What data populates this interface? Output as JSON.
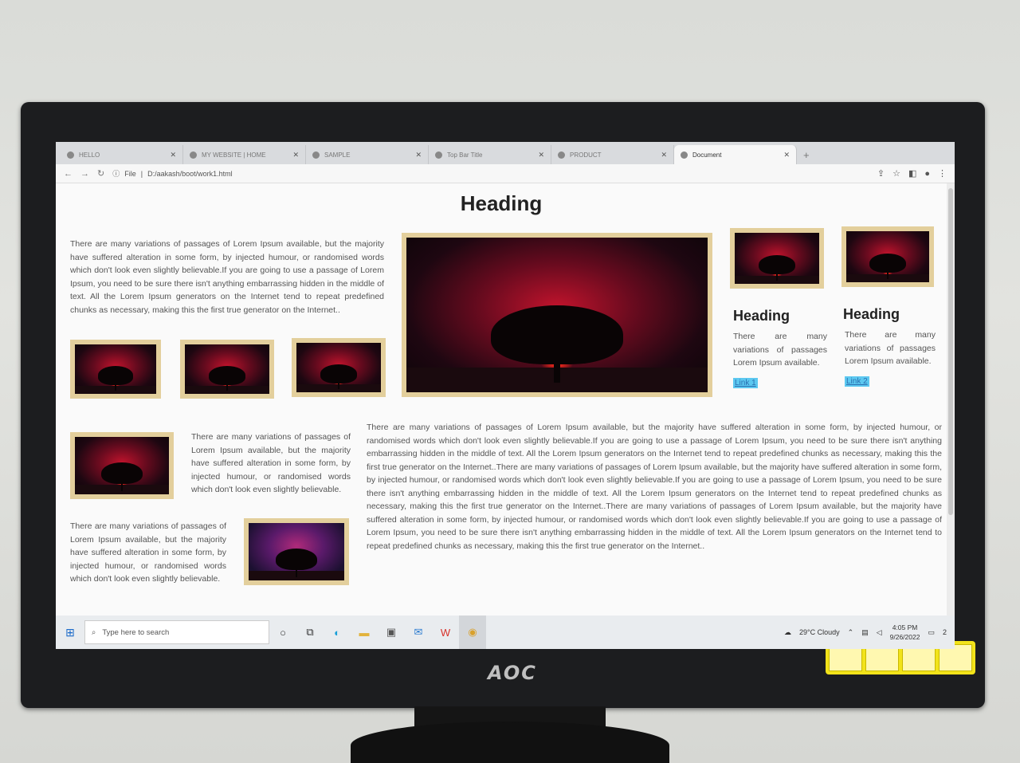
{
  "monitor": {
    "brand": "AOC"
  },
  "browser": {
    "tabs": [
      {
        "label": "HELLO",
        "active": false
      },
      {
        "label": "MY WEBSITE | HOME",
        "active": false
      },
      {
        "label": "SAMPLE",
        "active": false
      },
      {
        "label": "Top Bar Title",
        "active": false
      },
      {
        "label": "PRODUCT",
        "active": false
      },
      {
        "label": "Document",
        "active": true
      }
    ],
    "new_tab": "+",
    "address": {
      "scheme": "File",
      "path": "D:/aakash/boot/work1.html"
    }
  },
  "page": {
    "heading": "Heading",
    "intro_paragraph": "There are many variations of passages of Lorem Ipsum available, but the majority have suffered alteration in some form, by injected humour, or randomised words which don't look even slightly believable.If you are going to use a passage of Lorem Ipsum, you need to be sure there isn't anything embarrassing hidden in the middle of text. All the Lorem Ipsum generators on the Internet tend to repeat predefined chunks as necessary, making this the first true generator on the Internet..",
    "cards": [
      {
        "title": "Heading",
        "text": "There are many variations of passages Lorem Ipsum available.",
        "link": "Link 1"
      },
      {
        "title": "Heading",
        "text": "There are many variations of passages Lorem Ipsum available.",
        "link": "Link 2"
      }
    ],
    "media_text_1": "There are many variations of passages of Lorem Ipsum available, but the majority have suffered alteration in some form, by injected humour, or randomised words which don't look even slightly believable.",
    "media_text_2": "There are many variations of passages of Lorem Ipsum available, but the majority have suffered alteration in some form, by injected humour, or randomised words which don't look even slightly believable.",
    "long_paragraph": "There are many variations of passages of Lorem Ipsum available, but the majority have suffered alteration in some form, by injected humour, or randomised words which don't look even slightly believable.If you are going to use a passage of Lorem Ipsum, you need to be sure there isn't anything embarrassing hidden in the middle of text. All the Lorem Ipsum generators on the Internet tend to repeat predefined chunks as necessary, making this the first true generator on the Internet..There are many variations of passages of Lorem Ipsum available, but the majority have suffered alteration in some form, by injected humour, or randomised words which don't look even slightly believable.If you are going to use a passage of Lorem Ipsum, you need to be sure there isn't anything embarrassing hidden in the middle of text. All the Lorem Ipsum generators on the Internet tend to repeat predefined chunks as necessary, making this the first true generator on the Internet..There are many variations of passages of Lorem Ipsum available, but the majority have suffered alteration in some form, by injected humour, or randomised words which don't look even slightly believable.If you are going to use a passage of Lorem Ipsum, you need to be sure there isn't anything embarrassing hidden in the middle of text. All the Lorem Ipsum generators on the Internet tend to repeat predefined chunks as necessary, making this the first true generator on the Internet.."
  },
  "taskbar": {
    "search_placeholder": "Type here to search",
    "weather": "29°C  Cloudy",
    "time": "4:05 PM",
    "date": "9/26/2022",
    "notification_count": "2"
  },
  "icons": {
    "windows": "windows-icon",
    "search": "search-icon",
    "cortana": "cortana-icon",
    "taskview": "task-view-icon",
    "edge": "edge-icon",
    "explorer": "file-explorer-icon",
    "store": "store-icon",
    "mail": "mail-icon",
    "wps": "wps-icon",
    "chrome": "chrome-icon"
  }
}
